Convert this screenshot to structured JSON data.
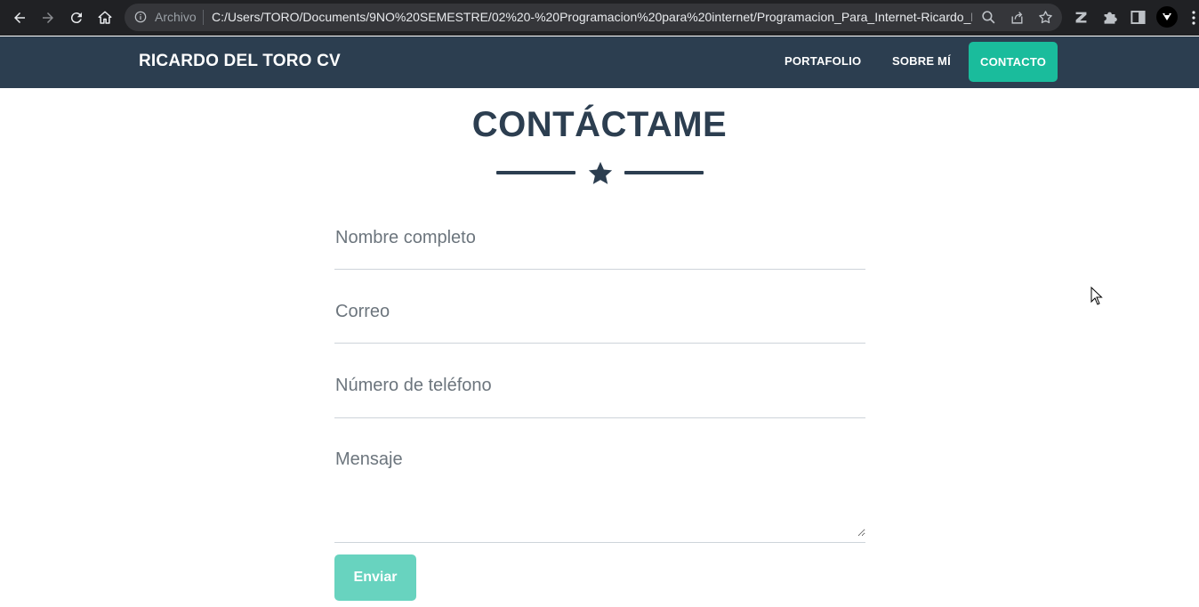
{
  "browser": {
    "scheme_label": "Archivo",
    "url": "C:/Users/TORO/Documents/9NO%20SEMESTRE/02%20-%20Programacion%20para%20internet/Programacion_Para_Internet-Ricardo_Ra..."
  },
  "navbar": {
    "brand": "RICARDO DEL TORO CV",
    "links": [
      {
        "label": "PORTAFOLIO"
      },
      {
        "label": "SOBRE MÍ"
      },
      {
        "label": "CONTACTO",
        "active": true
      }
    ]
  },
  "section": {
    "title": "CONTÁCTAME"
  },
  "form": {
    "name_placeholder": "Nombre completo",
    "email_placeholder": "Correo",
    "phone_placeholder": "Número de teléfono",
    "message_placeholder": "Mensaje",
    "submit_label": "Enviar"
  },
  "colors": {
    "primary": "#2c3e50",
    "accent": "#1abc9c",
    "button_disabled": "#68d3bf"
  }
}
